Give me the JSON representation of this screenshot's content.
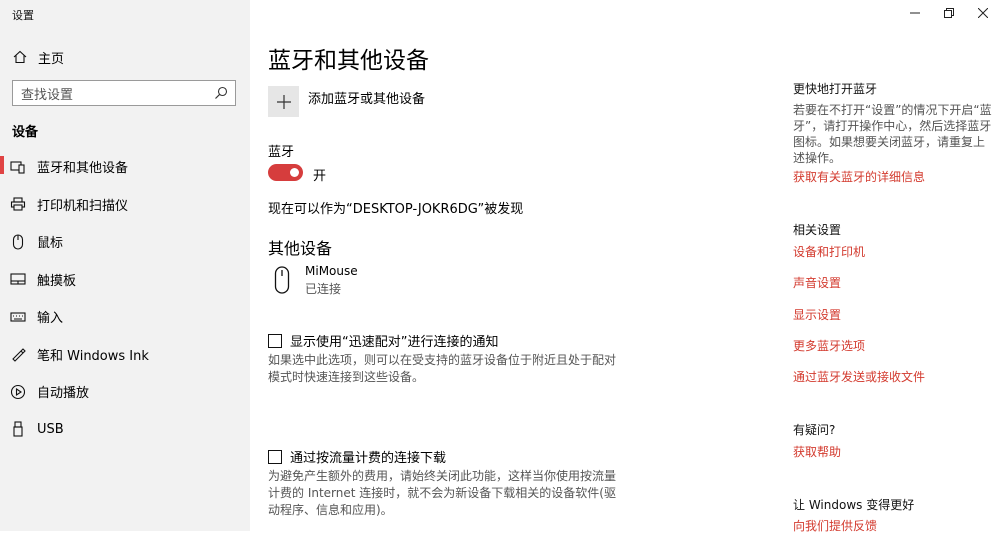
{
  "app": {
    "title": "设置"
  },
  "window_controls": {
    "minimize": "minimize",
    "maximize": "restore",
    "close": "close"
  },
  "sidebar": {
    "home_label": "主页",
    "search_placeholder": "查找设置",
    "section_title": "设备",
    "items": [
      {
        "label": "蓝牙和其他设备",
        "icon": "bluetooth-devices-icon",
        "active": true
      },
      {
        "label": "打印机和扫描仪",
        "icon": "printer-icon"
      },
      {
        "label": "鼠标",
        "icon": "mouse-icon"
      },
      {
        "label": "触摸板",
        "icon": "touchpad-icon"
      },
      {
        "label": "输入",
        "icon": "keyboard-icon"
      },
      {
        "label": "笔和 Windows Ink",
        "icon": "pen-icon"
      },
      {
        "label": "自动播放",
        "icon": "autoplay-icon"
      },
      {
        "label": "USB",
        "icon": "usb-icon"
      }
    ]
  },
  "main": {
    "title": "蓝牙和其他设备",
    "add_device_label": "添加蓝牙或其他设备",
    "bluetooth_label": "蓝牙",
    "bluetooth_toggle": {
      "on": true,
      "state_label": "开"
    },
    "discoverable_text": "现在可以作为“DESKTOP-JOKR6DG”被发现",
    "other_devices_title": "其他设备",
    "device": {
      "name": "MiMouse",
      "status": "已连接",
      "icon": "mouse-icon"
    },
    "swift_pair": {
      "checked": false,
      "label": "显示使用“迅速配对”进行连接的通知",
      "description": "如果选中此选项，则可以在受支持的蓝牙设备位于附近且处于配对模式时快速连接到这些设备。"
    },
    "metered": {
      "checked": false,
      "label": "通过按流量计费的连接下载",
      "description": "为避免产生额外的费用，请始终关闭此功能，这样当你使用按流量计费的 Internet 连接时，就不会为新设备下载相关的设备软件(驱动程序、信息和应用)。"
    }
  },
  "right": {
    "quick_title": "更快地打开蓝牙",
    "quick_text": "若要在不打开“设置”的情况下开启“蓝牙”，请打开操作中心，然后选择蓝牙图标。如果想要关闭蓝牙，请重复上述操作。",
    "quick_link": "获取有关蓝牙的详细信息",
    "related_title": "相关设置",
    "related_links": [
      "设备和打印机",
      "声音设置",
      "显示设置",
      "更多蓝牙选项",
      "通过蓝牙发送或接收文件"
    ],
    "question_title": "有疑问?",
    "help_link": "获取帮助",
    "improve_title": "让 Windows 变得更好",
    "feedback_link": "向我们提供反馈"
  },
  "colors": {
    "accent": "#d33a2e",
    "sidebar_bg": "#f2f2f2",
    "toggle_on": "#d63d3d"
  }
}
